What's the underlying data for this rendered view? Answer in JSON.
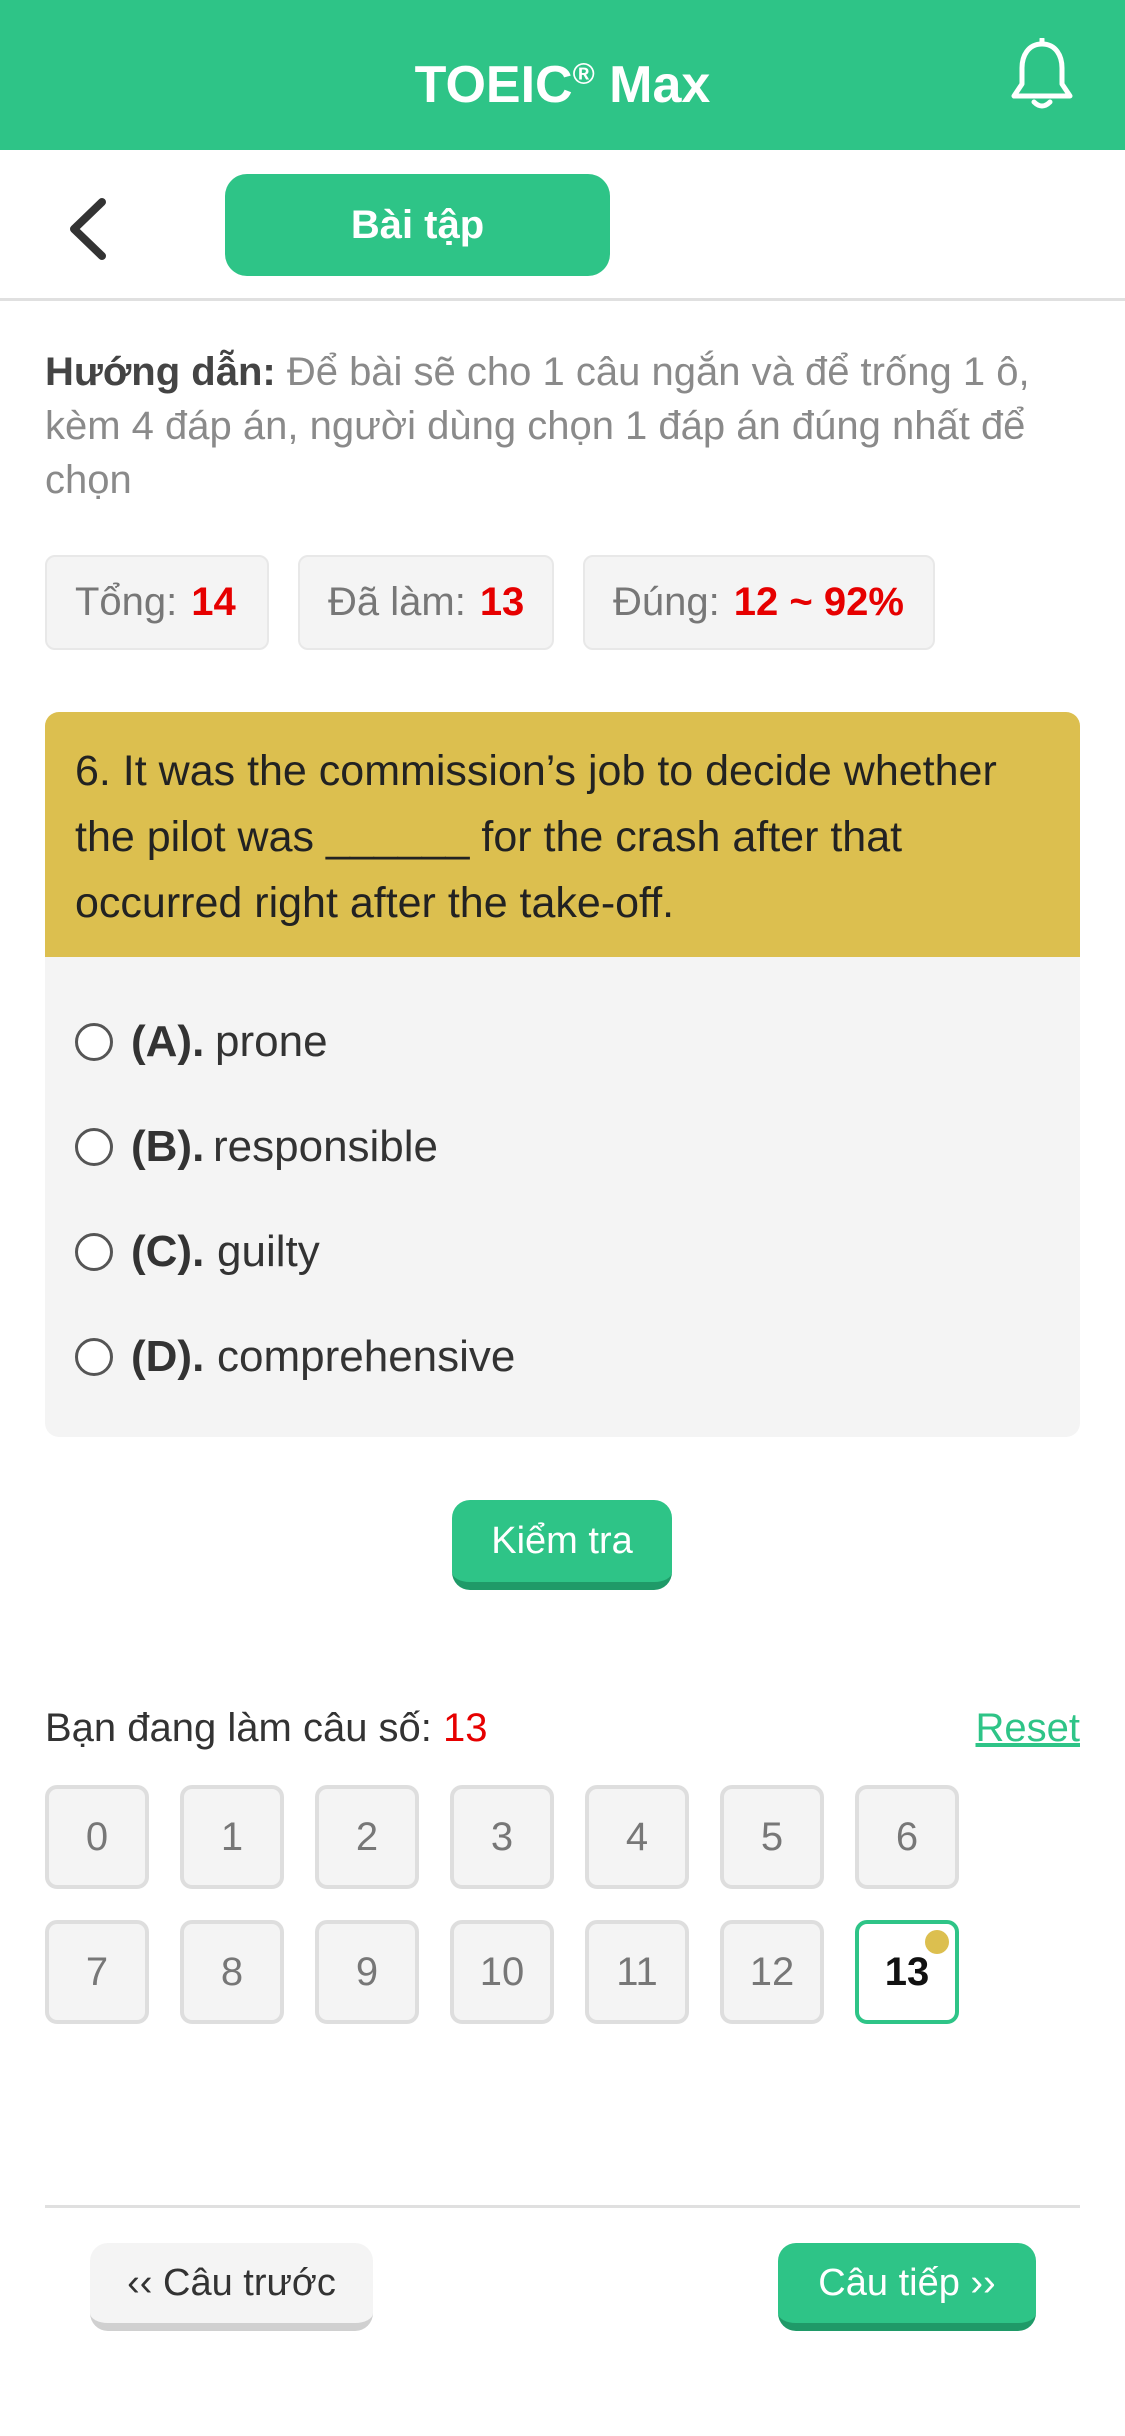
{
  "appbar": {
    "title": "TOEIC",
    "title_mark": "®",
    "title_suffix": " Max",
    "bell_icon": "bell-icon"
  },
  "nav": {
    "back_icon": "chevron-left-icon",
    "tab_label": "Bài tập"
  },
  "guide": {
    "label": "Hướng dẫn:",
    "text": " Để bài sẽ cho 1 câu ngắn và để trống 1 ô, kèm 4 đáp án, người dùng chọn 1 đáp án đúng nhất để chọn"
  },
  "stats": {
    "total_label": "Tổng:",
    "total_value": "14",
    "done_label": "Đã làm:",
    "done_value": "13",
    "correct_label": "Đúng:",
    "correct_value": "12 ~ 92%"
  },
  "question": {
    "text": "6. It was the commission’s job to decide whether the pilot was ______ for the crash after that occurred right after the take-off.",
    "options": [
      {
        "letter": "(A).",
        "text": "prone"
      },
      {
        "letter": "(B).",
        "text": "responsible"
      },
      {
        "letter": "(C).",
        "text": "guilty"
      },
      {
        "letter": "(D).",
        "text": "comprehensive"
      }
    ]
  },
  "check_label": "Kiểm tra",
  "progress": {
    "current_label": "Bạn đang làm câu số:",
    "current_value": "13",
    "reset_label": "Reset",
    "numbers": [
      "0",
      "1",
      "2",
      "3",
      "4",
      "5",
      "6",
      "7",
      "8",
      "9",
      "10",
      "11",
      "12",
      "13"
    ],
    "active": "13"
  },
  "footer": {
    "prev_label": "‹‹ Câu trước",
    "next_label": "Câu tiếp ››"
  },
  "colors": {
    "primary": "#2ec487",
    "question_header": "#dcbf4f",
    "accent_red": "#e60000"
  }
}
